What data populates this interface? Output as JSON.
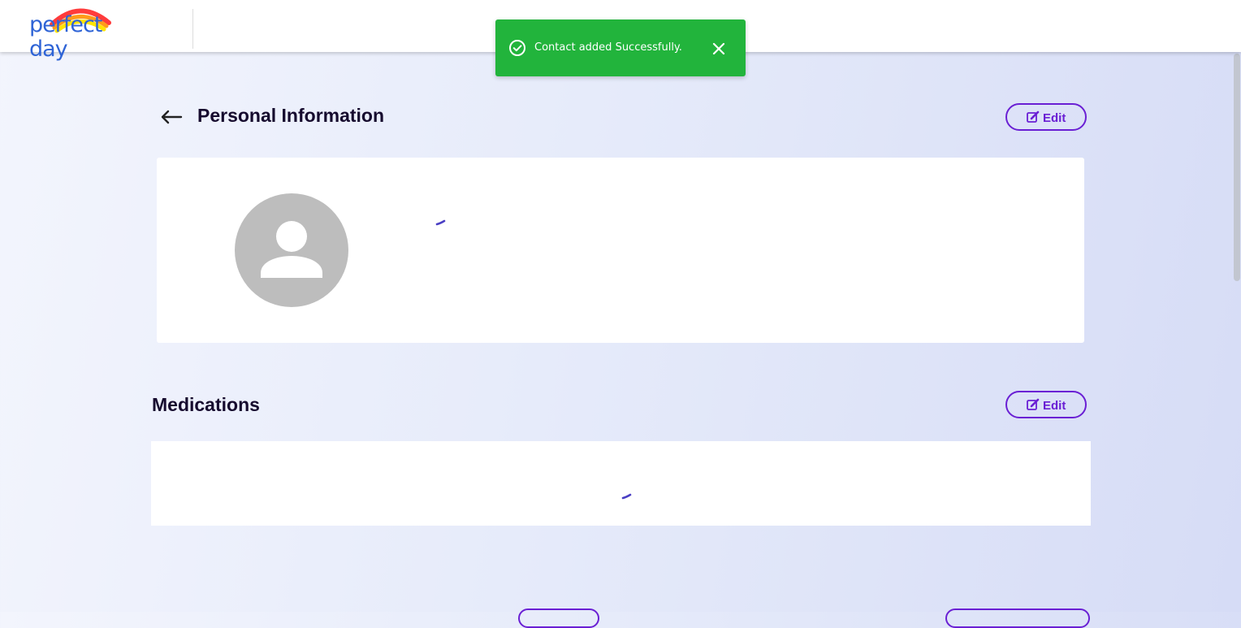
{
  "header": {
    "logo_text": "perfect day",
    "colors": {
      "logo_text": "#2f64d6",
      "rainbow": [
        "#ff3b3b",
        "#ff9b1a",
        "#ffe500"
      ]
    }
  },
  "toast": {
    "message": "Contact added Successfully.",
    "status": "success",
    "color": "#22b43c",
    "icons": {
      "status": "check-circle-icon",
      "close": "close-icon"
    }
  },
  "personal_info": {
    "title": "Personal Information",
    "edit_label": "Edit",
    "back_icon": "arrow-left-icon",
    "avatar_icon": "person-icon",
    "loading": true
  },
  "medications": {
    "title": "Medications",
    "edit_label": "Edit",
    "loading": true
  },
  "theme": {
    "accent": "#6a1fd4",
    "spinner": "#4a3fc4",
    "heading_text": "#160b2e"
  }
}
